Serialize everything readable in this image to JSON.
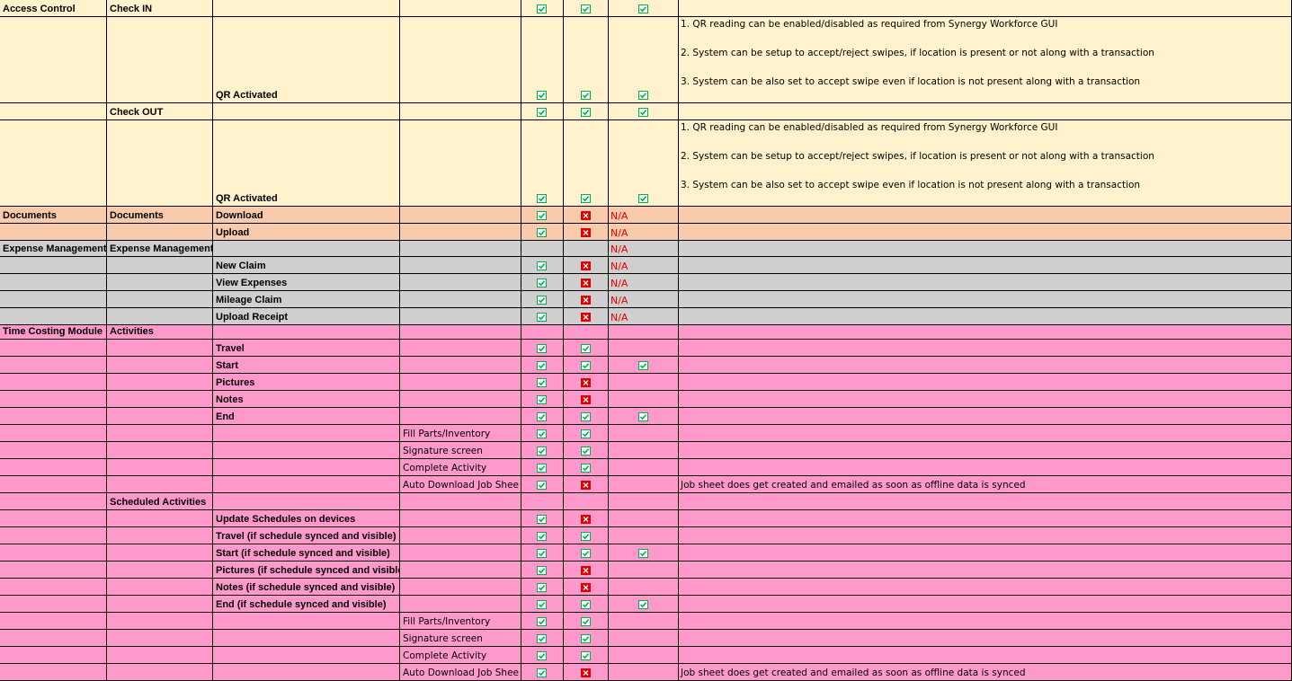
{
  "colors": {
    "yellow": "#FFF2CC",
    "orange": "#F8CBAD",
    "gray": "#D0CECE",
    "pink": "#FF99CC",
    "ok": "#00B050",
    "fail": "#E00000"
  },
  "icons": {
    "ok": "checkbox-checked-icon",
    "fail": "checkbox-cross-icon"
  },
  "rows": [
    {
      "bg": "yellow",
      "c": [
        "Access Control",
        "Check IN",
        "",
        "",
        ""
      ],
      "i": [
        "ok",
        "ok",
        "ok"
      ]
    },
    {
      "bg": "yellow",
      "tall": true,
      "c": [
        "",
        "",
        "QR Activated",
        "",
        ""
      ],
      "i": [
        "ok",
        "ok",
        "ok"
      ],
      "notes": [
        "1. QR reading can be enabled/disabled as required from Synergy Workforce GUI",
        "2. System can be setup to accept/reject swipes, if location is present or not along with a transaction",
        "3. System can be also set to accept swipe even if location is not present along with a transaction"
      ]
    },
    {
      "bg": "yellow",
      "c": [
        "",
        "Check OUT",
        "",
        "",
        ""
      ],
      "i": [
        "ok",
        "ok",
        "ok"
      ]
    },
    {
      "bg": "yellow",
      "tall": true,
      "c": [
        "",
        "",
        "QR Activated",
        "",
        ""
      ],
      "i": [
        "ok",
        "ok",
        "ok"
      ],
      "notes": [
        "1. QR reading can be enabled/disabled as required from Synergy Workforce GUI",
        "2. System can be setup to accept/reject swipes, if location is present or not along with a transaction",
        "3. System can be also set to accept swipe even if location is not present along with a transaction"
      ]
    },
    {
      "bg": "orange",
      "c": [
        "Documents",
        "Documents",
        "Download",
        "",
        ""
      ],
      "i": [
        "ok",
        "fail",
        "N/A"
      ]
    },
    {
      "bg": "orange",
      "c": [
        "",
        "",
        "Upload",
        "",
        ""
      ],
      "i": [
        "ok",
        "fail",
        "N/A"
      ]
    },
    {
      "bg": "gray",
      "c": [
        "Expense Management",
        "Expense Management",
        "",
        "",
        ""
      ],
      "i": [
        "",
        "",
        "N/A"
      ]
    },
    {
      "bg": "gray",
      "c": [
        "",
        "",
        "New Claim",
        "",
        ""
      ],
      "i": [
        "ok",
        "fail",
        "N/A"
      ]
    },
    {
      "bg": "gray",
      "c": [
        "",
        "",
        "View Expenses",
        "",
        ""
      ],
      "i": [
        "ok",
        "fail",
        "N/A"
      ]
    },
    {
      "bg": "gray",
      "c": [
        "",
        "",
        "Mileage Claim",
        "",
        ""
      ],
      "i": [
        "ok",
        "fail",
        "N/A"
      ]
    },
    {
      "bg": "gray",
      "c": [
        "",
        "",
        "Upload Receipt",
        "",
        ""
      ],
      "i": [
        "ok",
        "fail",
        "N/A"
      ]
    },
    {
      "bg": "pink",
      "c": [
        "Time Costing Module",
        "Activities",
        "",
        "",
        ""
      ],
      "i": [
        "",
        "",
        ""
      ]
    },
    {
      "bg": "pink",
      "c": [
        "",
        "",
        "Travel",
        "",
        ""
      ],
      "i": [
        "ok",
        "ok",
        ""
      ]
    },
    {
      "bg": "pink",
      "c": [
        "",
        "",
        "Start",
        "",
        ""
      ],
      "i": [
        "ok",
        "ok",
        "ok"
      ]
    },
    {
      "bg": "pink",
      "c": [
        "",
        "",
        "Pictures",
        "",
        ""
      ],
      "i": [
        "ok",
        "fail",
        ""
      ]
    },
    {
      "bg": "pink",
      "c": [
        "",
        "",
        "Notes",
        "",
        ""
      ],
      "i": [
        "ok",
        "fail",
        ""
      ]
    },
    {
      "bg": "pink",
      "c": [
        "",
        "",
        "End",
        "",
        ""
      ],
      "i": [
        "ok",
        "ok",
        "ok"
      ]
    },
    {
      "bg": "pink",
      "c": [
        "",
        "",
        "",
        "Fill Parts/Inventory",
        ""
      ],
      "i": [
        "ok",
        "ok",
        ""
      ]
    },
    {
      "bg": "pink",
      "c": [
        "",
        "",
        "",
        "Signature screen",
        ""
      ],
      "i": [
        "ok",
        "ok",
        ""
      ]
    },
    {
      "bg": "pink",
      "c": [
        "",
        "",
        "",
        "Complete Activity",
        ""
      ],
      "i": [
        "ok",
        "ok",
        ""
      ]
    },
    {
      "bg": "pink",
      "c": [
        "",
        "",
        "",
        "Auto Download Job Shee",
        "Job sheet does get created and emailed as soon as offline data is synced"
      ],
      "i": [
        "ok",
        "fail",
        ""
      ]
    },
    {
      "bg": "pink",
      "c": [
        "",
        "Scheduled Activities",
        "",
        "",
        ""
      ],
      "i": [
        "",
        "",
        ""
      ]
    },
    {
      "bg": "pink",
      "c": [
        "",
        "",
        "Update Schedules on devices",
        "",
        ""
      ],
      "i": [
        "ok",
        "fail",
        ""
      ]
    },
    {
      "bg": "pink",
      "c": [
        "",
        "",
        "Travel (if schedule synced and visible)",
        "",
        ""
      ],
      "i": [
        "ok",
        "ok",
        ""
      ]
    },
    {
      "bg": "pink",
      "c": [
        "",
        "",
        "Start (if schedule synced and visible)",
        "",
        ""
      ],
      "i": [
        "ok",
        "ok",
        "ok"
      ]
    },
    {
      "bg": "pink",
      "c": [
        "",
        "",
        "Pictures (if schedule synced and visible)",
        "",
        ""
      ],
      "i": [
        "ok",
        "fail",
        ""
      ]
    },
    {
      "bg": "pink",
      "c": [
        "",
        "",
        "Notes (if schedule synced and visible)",
        "",
        ""
      ],
      "i": [
        "ok",
        "fail",
        ""
      ]
    },
    {
      "bg": "pink",
      "c": [
        "",
        "",
        "End (if schedule synced and visible)",
        "",
        ""
      ],
      "i": [
        "ok",
        "ok",
        "ok"
      ]
    },
    {
      "bg": "pink",
      "c": [
        "",
        "",
        "",
        "Fill Parts/Inventory",
        ""
      ],
      "i": [
        "ok",
        "ok",
        ""
      ]
    },
    {
      "bg": "pink",
      "c": [
        "",
        "",
        "",
        "Signature screen",
        ""
      ],
      "i": [
        "ok",
        "ok",
        ""
      ]
    },
    {
      "bg": "pink",
      "c": [
        "",
        "",
        "",
        "Complete Activity",
        ""
      ],
      "i": [
        "ok",
        "ok",
        ""
      ]
    },
    {
      "bg": "pink",
      "c": [
        "",
        "",
        "",
        "Auto Download Job Shee",
        "Job sheet does get created and emailed as soon as offline data is synced"
      ],
      "i": [
        "ok",
        "fail",
        ""
      ]
    }
  ]
}
